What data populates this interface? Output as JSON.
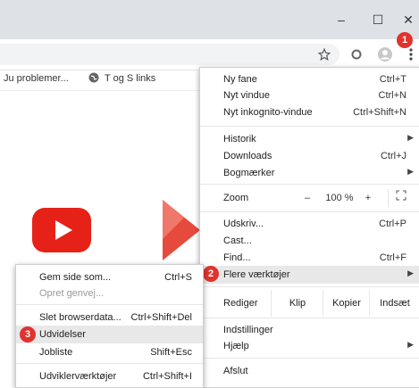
{
  "window": {
    "minimize": "–",
    "maximize": "☐",
    "close": "✕"
  },
  "bookmarks": [
    {
      "label": "Ju problemer..."
    },
    {
      "label": "T og S links"
    }
  ],
  "menu": {
    "items": {
      "new_tab": {
        "label": "Ny fane",
        "shortcut": "Ctrl+T"
      },
      "new_window": {
        "label": "Nyt vindue",
        "shortcut": "Ctrl+N"
      },
      "incognito": {
        "label": "Nyt inkognito-vindue",
        "shortcut": "Ctrl+Shift+N"
      },
      "history": {
        "label": "Historik"
      },
      "downloads": {
        "label": "Downloads",
        "shortcut": "Ctrl+J"
      },
      "bookmarks": {
        "label": "Bogmærker"
      },
      "zoom": {
        "label": "Zoom",
        "minus": "–",
        "value": "100 %",
        "plus": "+"
      },
      "print": {
        "label": "Udskriv...",
        "shortcut": "Ctrl+P"
      },
      "cast": {
        "label": "Cast..."
      },
      "find": {
        "label": "Find...",
        "shortcut": "Ctrl+F"
      },
      "more_tools": {
        "label": "Flere værktøjer"
      },
      "edit": {
        "label": "Rediger",
        "cut": "Klip",
        "copy": "Kopier",
        "paste": "Indsæt"
      },
      "settings": {
        "label": "Indstillinger"
      },
      "help": {
        "label": "Hjælp"
      },
      "exit": {
        "label": "Afslut"
      }
    }
  },
  "submenu": {
    "items": {
      "save_page": {
        "label": "Gem side som...",
        "shortcut": "Ctrl+S"
      },
      "create_shortcut": {
        "label": "Opret genvej..."
      },
      "clear_data": {
        "label": "Slet browserdata...",
        "shortcut": "Ctrl+Shift+Del"
      },
      "extensions": {
        "label": "Udvidelser"
      },
      "task_manager": {
        "label": "Jobliste",
        "shortcut": "Shift+Esc"
      },
      "dev_tools": {
        "label": "Udviklerværktøjer",
        "shortcut": "Ctrl+Shift+I"
      }
    }
  },
  "badges": {
    "one": "1",
    "two": "2",
    "three": "3"
  },
  "colors": {
    "badge": "#e0332f",
    "youtube": "#e62117",
    "highlight": "#e8e8e8"
  }
}
